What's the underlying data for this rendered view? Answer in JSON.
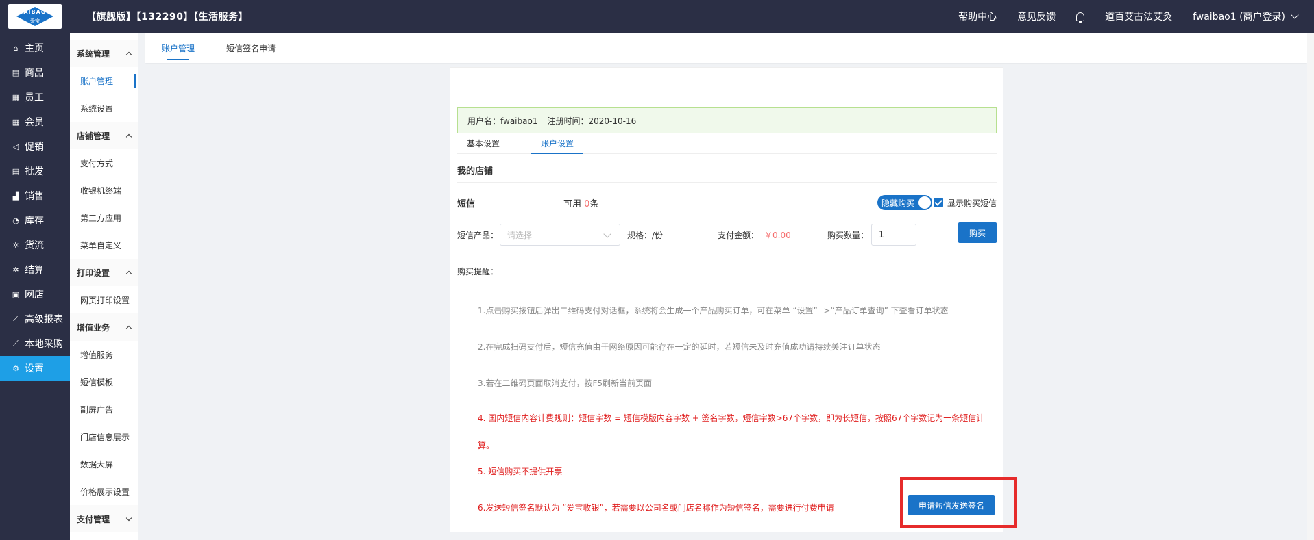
{
  "header": {
    "logo_text": "AIBAO",
    "logo_sub": "爱宝",
    "shop_title": "【旗舰版】【132290】【生活服务】",
    "help": "帮助中心",
    "feedback": "意见反馈",
    "store_name": "道百艾古法艾灸",
    "user": "fwaibao1 (商户登录)"
  },
  "nav": {
    "items": [
      {
        "label": "主页",
        "icon": "home-icon",
        "glyph": "⌂"
      },
      {
        "label": "商品",
        "icon": "goods-icon",
        "glyph": "▤"
      },
      {
        "label": "员工",
        "icon": "staff-icon",
        "glyph": "▦"
      },
      {
        "label": "会员",
        "icon": "member-icon",
        "glyph": "▦"
      },
      {
        "label": "促销",
        "icon": "promo-icon",
        "glyph": "◁"
      },
      {
        "label": "批发",
        "icon": "wholesale-icon",
        "glyph": "▤"
      },
      {
        "label": "销售",
        "icon": "sales-icon",
        "glyph": "▟"
      },
      {
        "label": "库存",
        "icon": "stock-icon",
        "glyph": "◔"
      },
      {
        "label": "货流",
        "icon": "logistics-icon",
        "glyph": "✲"
      },
      {
        "label": "结算",
        "icon": "settle-icon",
        "glyph": "✲"
      },
      {
        "label": "网店",
        "icon": "shop-icon",
        "glyph": "▣"
      },
      {
        "label": "高级报表",
        "icon": "report-icon",
        "glyph": "⟋"
      },
      {
        "label": "本地采购",
        "icon": "purchase-icon",
        "glyph": "⟋"
      },
      {
        "label": "设置",
        "icon": "settings-icon",
        "glyph": "⚙"
      }
    ]
  },
  "subnav": {
    "groups": [
      {
        "title": "系统管理",
        "items": [
          "账户管理",
          "系统设置"
        ]
      },
      {
        "title": "店铺管理",
        "items": [
          "支付方式",
          "收银机终端",
          "第三方应用",
          "菜单自定义"
        ]
      },
      {
        "title": "打印设置",
        "items": [
          "网页打印设置"
        ]
      },
      {
        "title": "增值业务",
        "items": [
          "增值服务",
          "短信模板",
          "副屏广告",
          "门店信息展示",
          "数据大屏",
          "价格展示设置"
        ]
      },
      {
        "title": "支付管理",
        "items": []
      }
    ]
  },
  "tabs": [
    "账户管理",
    "短信签名申请"
  ],
  "account": {
    "username_label": "用户名：fwaibao1",
    "register_label": "注册时间：2020-10-16",
    "subtabs": [
      "基本设置",
      "账户设置"
    ],
    "section_title": "我的店铺",
    "sms_label": "短信",
    "available_prefix": "可用",
    "available_count": "0",
    "available_unit": "条",
    "toggle_label": "隐藏购买",
    "show_buy_label": "显示购买短信",
    "product_label": "短信产品：",
    "product_placeholder": "请选择",
    "spec_label": "规格：/份",
    "amount_label": "支付金额：",
    "amount_value": "￥0.00",
    "qty_label": "购买数量：",
    "qty_value": "1",
    "buy_button": "购买",
    "tips_title": "购买提醒：",
    "tips": [
      "1.点击购买按钮后弹出二维码支付对话框，系统将会生成一个产品购买订单，可在菜单 “设置”-->“产品订单查询” 下查看订单状态",
      "2.在完成扫码支付后，短信充值由于网络原因可能存在一定的延时，若短信未及时充值成功请持续关注订单状态",
      "3.若在二维码页面取消支付，按F5刷新当前页面",
      "4. 国内短信内容计费规则：短信字数 = 短信模版内容字数 + 签名字数，短信字数>67个字数，即为长短信，按照67个字数记为一条短信计算。",
      "5. 短信购买不提供开票",
      "6.发送短信签名默认为 “爱宝收银”，若需要以公司名或门店名称作为短信签名，需要进行付费申请"
    ],
    "apply_button": "申请短信发送签名"
  },
  "colors": {
    "dark_bg": "#2b2f45",
    "accent": "#1a73c8",
    "active_nav": "#1e9fe6",
    "warning_red": "#e02020",
    "highlight_border": "#e62b2b"
  }
}
